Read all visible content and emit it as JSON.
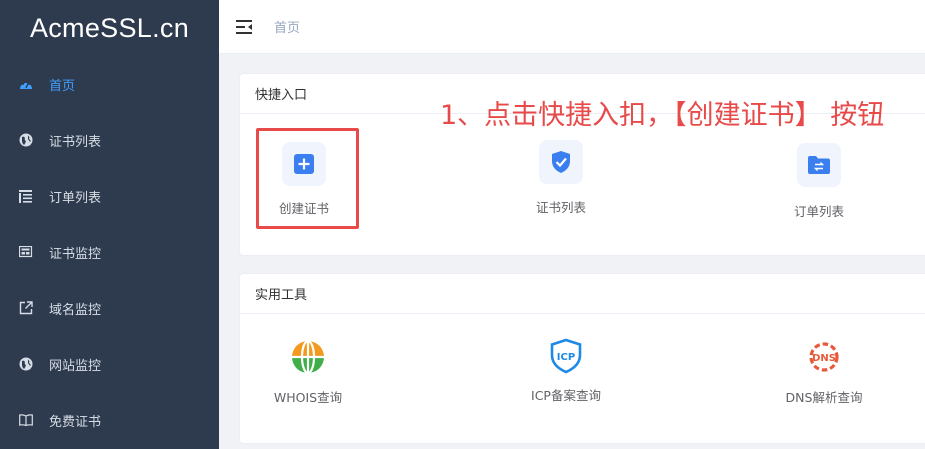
{
  "app": {
    "logo": "AcmeSSL.cn",
    "accent": "#409eff",
    "sidebar_bg": "#2e3b4e",
    "annotation_color": "#e84a4a"
  },
  "sidebar": {
    "items": [
      {
        "label": "首页",
        "icon": "dashboard-icon",
        "active": true
      },
      {
        "label": "证书列表",
        "icon": "globe-icon"
      },
      {
        "label": "订单列表",
        "icon": "list-icon"
      },
      {
        "label": "证书监控",
        "icon": "monitor-icon"
      },
      {
        "label": "域名监控",
        "icon": "external-link-icon"
      },
      {
        "label": "网站监控",
        "icon": "globe-icon"
      },
      {
        "label": "免费证书",
        "icon": "book-icon"
      }
    ]
  },
  "header": {
    "breadcrumb": "首页",
    "fold_icon": "menu-fold-icon"
  },
  "quick_entry": {
    "title": "快捷入口",
    "items": [
      {
        "label": "创建证书",
        "icon": "plus-square-icon"
      },
      {
        "label": "证书列表",
        "icon": "shield-check-icon"
      },
      {
        "label": "订单列表",
        "icon": "folder-transfer-icon"
      }
    ]
  },
  "tools": {
    "title": "实用工具",
    "items": [
      {
        "label": "WHOIS查询",
        "icon": "whois-globe-icon"
      },
      {
        "label": "ICP备案查询",
        "icon": "icp-shield-icon"
      },
      {
        "label": "DNS解析查询",
        "icon": "dns-gear-icon"
      }
    ]
  },
  "annotation": {
    "text": "1、点击快捷入扣，【创建证书】 按钮"
  }
}
